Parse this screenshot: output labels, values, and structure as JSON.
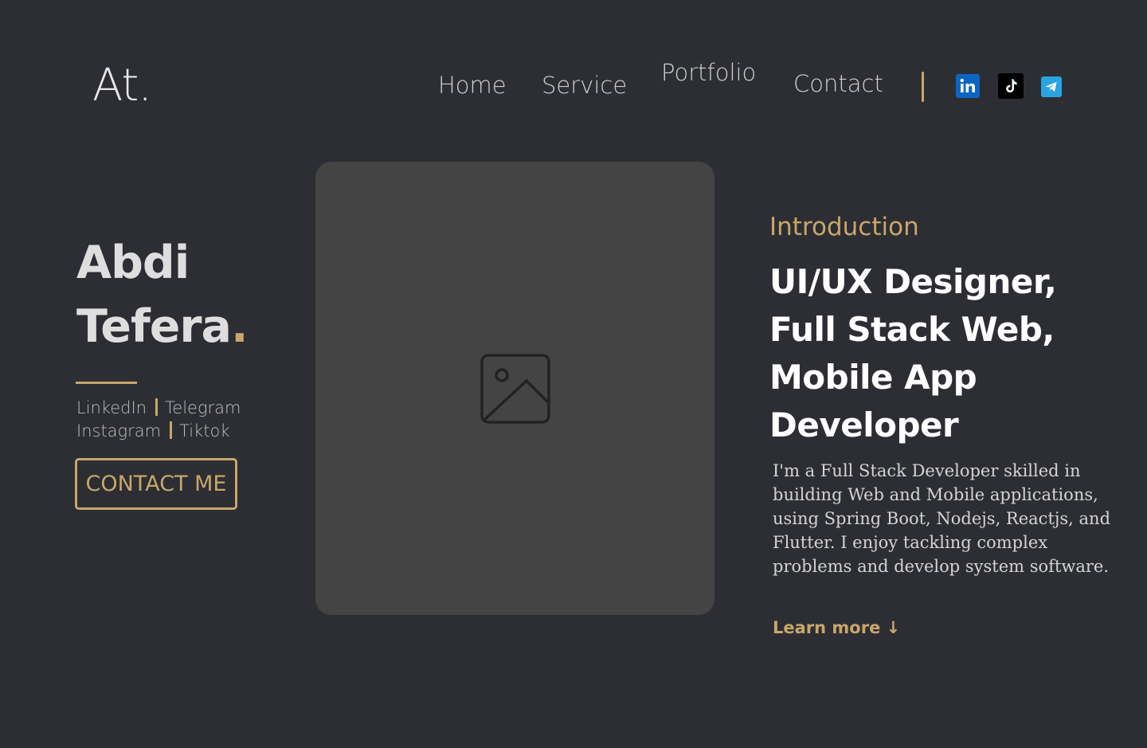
{
  "header": {
    "logo": "At.",
    "nav": [
      {
        "label": "Home"
      },
      {
        "label": "Service"
      },
      {
        "label": "Portfolio"
      },
      {
        "label": "Contact"
      }
    ],
    "social_icons": [
      "linkedin-icon",
      "tiktok-icon",
      "telegram-icon"
    ]
  },
  "hero": {
    "name_line1": "Abdi",
    "name_line2": "Tefera",
    "name_dot": ".",
    "links": {
      "linkedin": "LinkedIn",
      "telegram": "Telegram",
      "instagram": "Instagram",
      "tiktok": "Tiktok"
    },
    "contact_button": "CONTACT ME",
    "image_icon": "image-placeholder-icon"
  },
  "intro": {
    "label": "Introduction",
    "headline_lines": [
      "UI/UX Designer,",
      "Full Stack Web,",
      "Mobile App",
      "Developer"
    ],
    "bio": "I'm a Full Stack Developer skilled in building Web and Mobile applications, using Spring Boot, Nodejs, Reactjs, and Flutter.  I enjoy tackling complex problems and develop system software.",
    "learn_more": "Learn more ↓"
  },
  "colors": {
    "background": "#2d2e33",
    "accent": "#c7a76a",
    "card": "#444444",
    "linkedin": "#0a66c2",
    "telegram": "#2aa3e3"
  }
}
